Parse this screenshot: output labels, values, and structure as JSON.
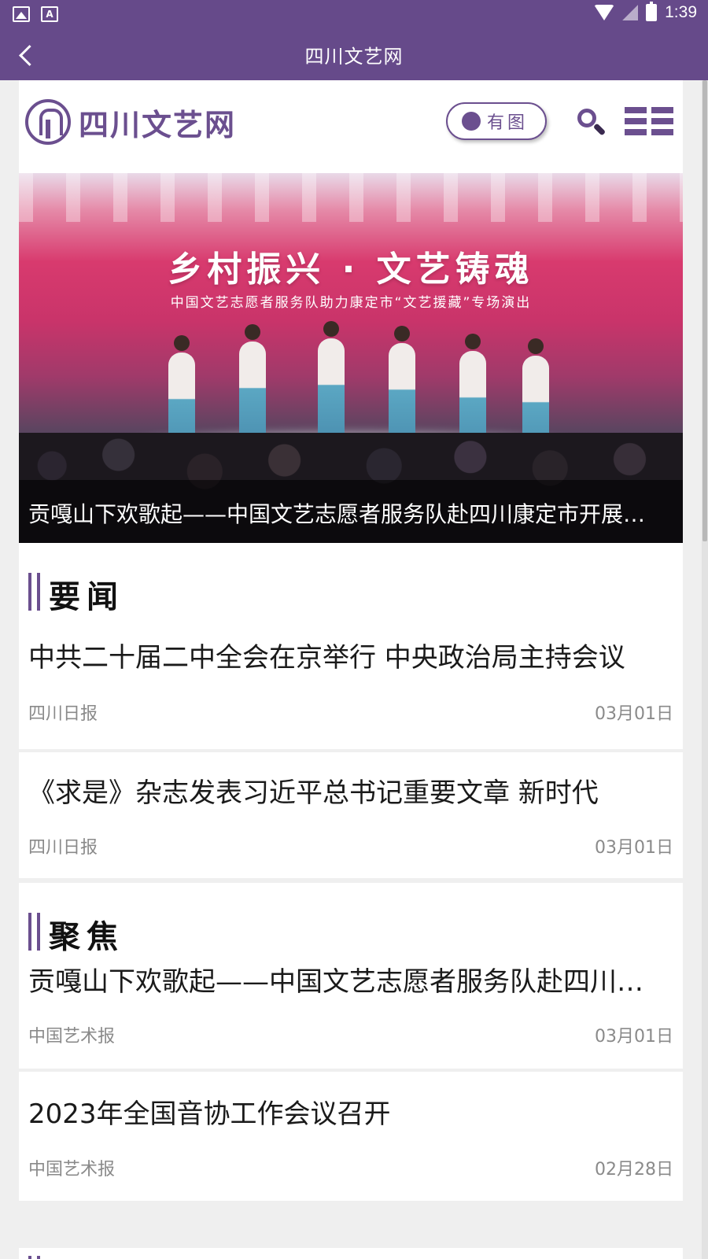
{
  "status_bar": {
    "time": "1:39",
    "icons": [
      "image-notification-icon",
      "font-notification-icon",
      "wifi-icon",
      "no-signal-icon",
      "battery-charging-icon"
    ]
  },
  "app_bar": {
    "title": "四川文艺网",
    "back_icon": "chevron-left-icon"
  },
  "site_header": {
    "logo_text": "四川文艺网",
    "image_toggle_label": "有图",
    "search_icon": "search-icon",
    "menu_icon": "menu-grid-icon"
  },
  "banner": {
    "headline": "乡村振兴 · 文艺铸魂",
    "subline": "中国文艺志愿者服务队助力康定市“文艺援藏”专场演出",
    "caption": "贡嘎山下欢歌起——中国文艺志愿者服务队赴四川康定市开展文艺志愿服务活动"
  },
  "sections": [
    {
      "title": "要闻",
      "items": [
        {
          "title": "中共二十届二中全会在京举行 中央政治局主持会议",
          "source": "四川日报",
          "date": "03月01日"
        },
        {
          "title": "《求是》杂志发表习近平总书记重要文章 新时代",
          "source": "四川日报",
          "date": "03月01日"
        }
      ]
    },
    {
      "title": "聚焦",
      "items": [
        {
          "title": "贡嘎山下欢歌起——中国文艺志愿者服务队赴四川康定",
          "source": "中国艺术报",
          "date": "03月01日"
        },
        {
          "title": "2023年全国音协工作会议召开",
          "source": "中国艺术报",
          "date": "02月28日"
        }
      ]
    }
  ],
  "colors": {
    "brand_purple": "#664a8a",
    "accent_purple": "#6b4f8f",
    "meta_gray": "#8a8a8a",
    "divider": "#efefef"
  }
}
